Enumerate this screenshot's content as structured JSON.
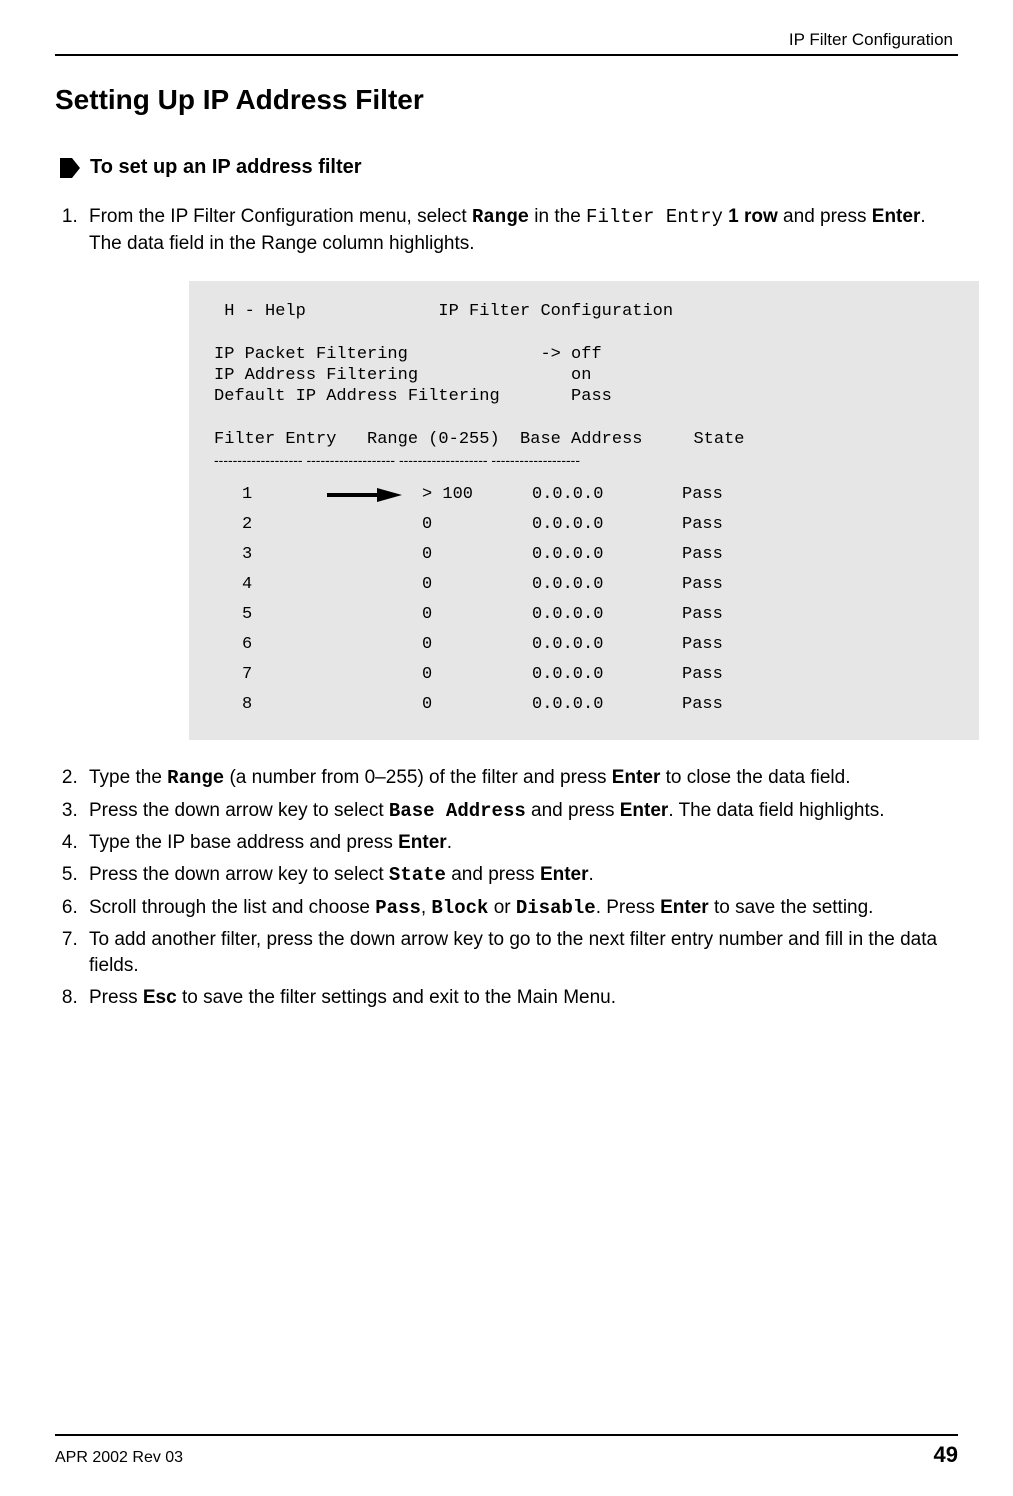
{
  "header": {
    "running_title": "IP Filter Configuration"
  },
  "section": {
    "title": "Setting Up IP Address Filter"
  },
  "procedure": {
    "title": "To set up an IP address filter"
  },
  "steps": {
    "s1a": "From the IP Filter Configuration menu, select ",
    "s1b": "Range",
    "s1c": " in the ",
    "s1d": "Filter Entry",
    "s1e": " 1 row",
    "s1f": " and press ",
    "s1g": "Enter",
    "s1h": ". The data field in the Range column highlights.",
    "s2a": "Type the ",
    "s2b": "Range",
    "s2c": " (a number from 0–255) of the filter and press ",
    "s2d": "Enter",
    "s2e": " to close the data field.",
    "s3a": "Press the down arrow key to select ",
    "s3b": "Base Address",
    "s3c": " and press ",
    "s3d": "Enter",
    "s3e": ". The data field highlights.",
    "s4a": "Type the IP base address and press ",
    "s4b": "Enter",
    "s4c": ".",
    "s5a": "Press the down arrow key to select ",
    "s5b": "State",
    "s5c": " and press ",
    "s5d": "Enter",
    "s5e": ".",
    "s6a": "Scroll through the list and choose ",
    "s6b": "Pass",
    "s6c": ", ",
    "s6d": "Block",
    "s6e": " or ",
    "s6f": "Disable",
    "s6g": ". Press ",
    "s6h": "Enter",
    "s6i": " to save the setting.",
    "s7": "To add another filter, press the down arrow key to go to the next filter entry number and fill in the data fields.",
    "s8a": "Press ",
    "s8b": "Esc",
    "s8c": " to save the filter settings and exit to the Main Menu."
  },
  "terminal": {
    "line_help": " H - Help             IP Filter Configuration",
    "line_pf": "IP Packet Filtering             -> off",
    "line_af": "IP Address Filtering               on",
    "line_def": "Default IP Address Filtering       Pass",
    "line_hdr": "Filter Entry   Range (0-255)  Base Address     State",
    "dash": "-------------------      -------------------     -------------------       -------------------",
    "rows": [
      {
        "entry": "1",
        "arrow": true,
        "range": "> 100",
        "base": "0.0.0.0",
        "state": "Pass"
      },
      {
        "entry": "2",
        "arrow": false,
        "range": "  0",
        "base": "0.0.0.0",
        "state": "Pass"
      },
      {
        "entry": "3",
        "arrow": false,
        "range": "  0",
        "base": "0.0.0.0",
        "state": "Pass"
      },
      {
        "entry": "4",
        "arrow": false,
        "range": "  0",
        "base": "0.0.0.0",
        "state": "Pass"
      },
      {
        "entry": "5",
        "arrow": false,
        "range": "  0",
        "base": "0.0.0.0",
        "state": "Pass"
      },
      {
        "entry": "6",
        "arrow": false,
        "range": "  0",
        "base": "0.0.0.0",
        "state": "Pass"
      },
      {
        "entry": "7",
        "arrow": false,
        "range": "  0",
        "base": "0.0.0.0",
        "state": "Pass"
      },
      {
        "entry": "8",
        "arrow": false,
        "range": "  0",
        "base": "0.0.0.0",
        "state": "Pass"
      }
    ]
  },
  "footer": {
    "left": "APR 2002 Rev 03",
    "page": "49"
  }
}
